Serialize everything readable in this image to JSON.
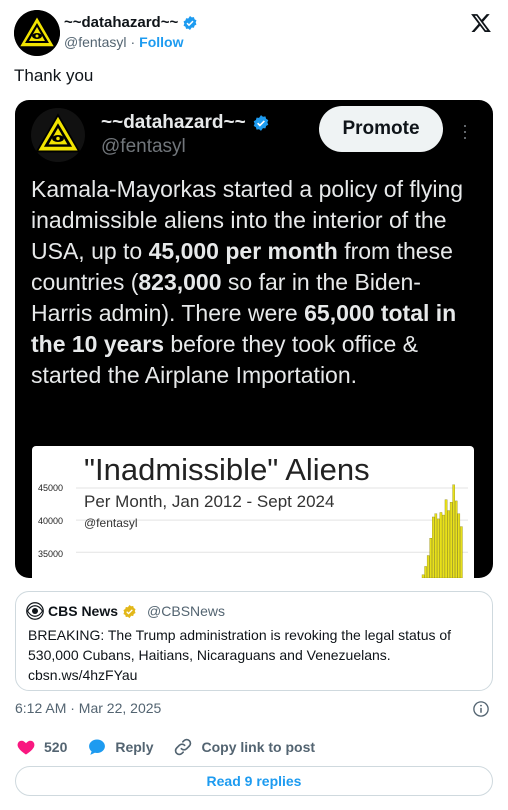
{
  "author": {
    "name": "~~datahazard~~",
    "handle": "@fentasyl",
    "separator": "·",
    "follow_label": "Follow",
    "verified": true
  },
  "tweet_text": "Thank you",
  "media": {
    "author_name": "~~datahazard~~",
    "author_handle": "@fentasyl",
    "promote_label": "Promote",
    "body": {
      "p1": "Kamala-Mayorkas started a policy of flying inadmissible aliens into the interior of the USA, up to ",
      "b1": "45,000 per month",
      "p2": " from these countries (",
      "b2": "823,000",
      "p3": " so far in the Biden-Harris admin). There were ",
      "b3": "65,000 total in the 10 years",
      "p4": " before they took office & started the Airplane Importation."
    },
    "chart": {
      "title": "\"Inadmissible\" Aliens",
      "subtitle": "Per Month, Jan 2012 - Sept 2024",
      "handle": "@fentasyl",
      "y_ticks": [
        "45000",
        "40000",
        "35000"
      ]
    }
  },
  "quote": {
    "name": "CBS News",
    "handle": "@CBSNews",
    "text": "BREAKING: The Trump administration is revoking the legal status of 530,000 Cubans, Haitians, Nicaraguans and Venezuelans.",
    "link": "cbsn.ws/4hzFYau"
  },
  "timestamp": "6:12 AM · Mar 22, 2025",
  "actions": {
    "likes": "520",
    "reply_label": "Reply",
    "copy_label": "Copy link to post"
  },
  "read_replies_label": "Read 9 replies",
  "colors": {
    "accent": "#1d9bf0",
    "like": "#f91880",
    "chart_bar": "#e8e01a"
  },
  "chart_data": {
    "type": "bar",
    "title": "\"Inadmissible\" Aliens",
    "subtitle": "Per Month, Jan 2012 - Sept 2024",
    "ylim": [
      31000,
      47500
    ],
    "visible_values": [
      31500,
      32800,
      34500,
      37200,
      40500,
      41000,
      40200,
      41200,
      40800,
      43200,
      41500,
      42800,
      45500,
      43000,
      41000,
      39000
    ]
  }
}
